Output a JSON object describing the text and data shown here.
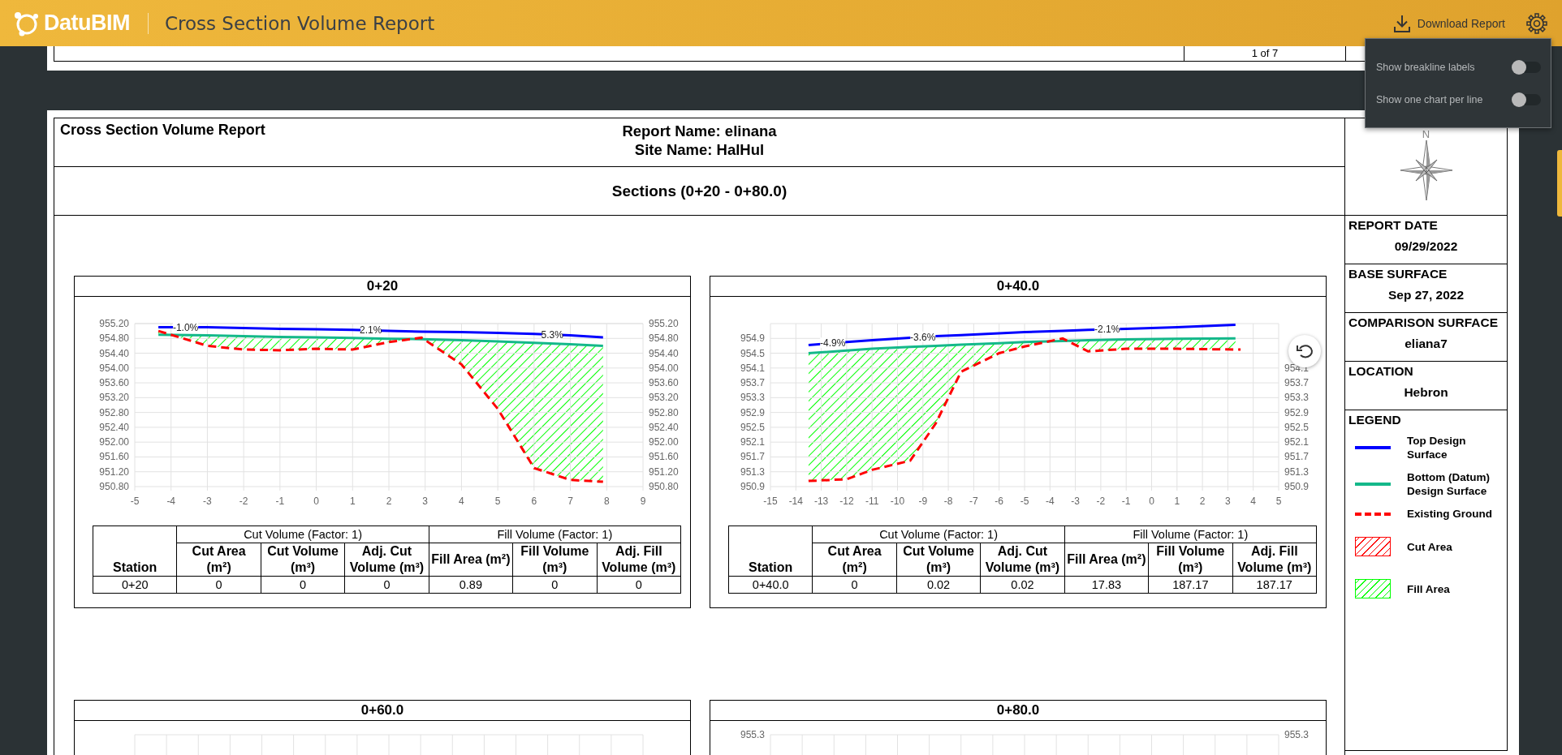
{
  "header": {
    "logo": "DatuBIM",
    "title": "Cross Section Volume Report",
    "download_button": "Download Report"
  },
  "settings_menu": {
    "items": [
      {
        "label": "Show breakline labels",
        "on": false
      },
      {
        "label": "Show one chart per line",
        "on": false
      }
    ]
  },
  "previous_page": {
    "page_number": "1 of 7"
  },
  "report": {
    "title": "Cross Section Volume Report",
    "report_name": "Report Name: elinana",
    "site_name": "Site Name: HalHul",
    "sections_title": "Sections (0+20 - 0+80.0)",
    "compass_label": "N",
    "info": [
      {
        "label": "REPORT DATE",
        "value": "09/29/2022"
      },
      {
        "label": "BASE SURFACE",
        "value": "Sep 27, 2022"
      },
      {
        "label": "COMPARISON SURFACE",
        "value": "eliana7"
      },
      {
        "label": "LOCATION",
        "value": "Hebron"
      }
    ],
    "legend": {
      "title": "LEGEND",
      "items": [
        {
          "label": "Top Design Surface",
          "kind": "line",
          "color": "#0000ff"
        },
        {
          "label": "Bottom (Datum) Design Surface",
          "kind": "line",
          "color": "#14b88a"
        },
        {
          "label": "Existing Ground",
          "kind": "dashed",
          "color": "#ff0000"
        },
        {
          "label": "Cut Area",
          "kind": "hatch",
          "color": "#ff0000"
        },
        {
          "label": "Fill Area",
          "kind": "hatch",
          "color": "#00ff00"
        }
      ]
    },
    "sections": [
      {
        "station": "0+20",
        "reset_button": false,
        "chart_data": {
          "type": "line",
          "grid": true,
          "x": [
            -4.35,
            -3,
            -2,
            -1,
            0,
            1,
            2,
            2.9,
            4,
            5,
            6,
            7,
            7.9
          ],
          "xlim": [
            -5,
            9
          ],
          "ylim": [
            950.8,
            955.2
          ],
          "y2lim": [
            950.8,
            955.2
          ],
          "xticks": [
            -5,
            -4,
            -3,
            -2,
            -1,
            0,
            1,
            2,
            3,
            4,
            5,
            6,
            7,
            8,
            9
          ],
          "yticks": [
            {
              "value": 950.8,
              "label": "950.80"
            },
            {
              "value": 951.2,
              "label": "951.20"
            },
            {
              "value": 951.6,
              "label": "951.60"
            },
            {
              "value": 952,
              "label": "952.00"
            },
            {
              "value": 952.4,
              "label": "952.40"
            },
            {
              "value": 952.8,
              "label": "952.80"
            },
            {
              "value": 953.2,
              "label": "953.20"
            },
            {
              "value": 953.6,
              "label": "953.60"
            },
            {
              "value": 954,
              "label": "954.00"
            },
            {
              "value": 954.4,
              "label": "954.40"
            },
            {
              "value": 954.8,
              "label": "954.80"
            },
            {
              "value": 955.2,
              "label": "955.20"
            }
          ],
          "y2ticks": [
            {
              "value": 950.8,
              "label": "950.80"
            },
            {
              "value": 951.2,
              "label": "951.20"
            },
            {
              "value": 951.6,
              "label": "951.60"
            },
            {
              "value": 952,
              "label": "952.00"
            },
            {
              "value": 952.4,
              "label": "952.40"
            },
            {
              "value": 952.8,
              "label": "952.80"
            },
            {
              "value": 953.2,
              "label": "953.20"
            },
            {
              "value": 953.6,
              "label": "953.60"
            },
            {
              "value": 954,
              "label": "954.00"
            },
            {
              "value": 954.4,
              "label": "954.40"
            },
            {
              "value": 954.8,
              "label": "954.80"
            },
            {
              "value": 955.2,
              "label": "955.20"
            }
          ],
          "series": [
            {
              "color": "#0000ff",
              "line_style": "solid",
              "values": [
                955.1,
                955.1,
                955.08,
                955.06,
                955.05,
                955.03,
                955.0,
                954.98,
                954.97,
                954.95,
                954.92,
                954.88,
                954.83
              ]
            },
            {
              "color": "#14b88a",
              "line_style": "solid",
              "values": [
                954.9,
                954.88,
                954.86,
                954.84,
                954.83,
                954.81,
                954.79,
                954.78,
                954.75,
                954.72,
                954.68,
                954.64,
                954.6
              ]
            },
            {
              "color": "#ff0000",
              "line_style": "dashed",
              "values": [
                955.0,
                954.6,
                954.5,
                954.48,
                954.52,
                954.5,
                954.7,
                954.82,
                954.1,
                952.9,
                951.3,
                950.98,
                950.93
              ]
            }
          ],
          "annotations": [
            {
              "x": -3.6,
              "y": 955.1,
              "text": "-1.0%"
            },
            {
              "x": 1.5,
              "y": 955.02,
              "text": "2.1%"
            },
            {
              "x": 6.5,
              "y": 954.9,
              "text": "5.3%"
            }
          ]
        },
        "table": {
          "group_headers": [
            "Cut Volume (Factor: 1)",
            "Fill Volume (Factor: 1)"
          ],
          "columns": [
            "Station",
            "Cut Area (m²)",
            "Cut Volume (m³)",
            "Adj. Cut Volume (m³)",
            "Fill Area (m²)",
            "Fill Volume (m³)",
            "Adj. Fill Volume (m³)"
          ],
          "rows": [
            [
              "0+20",
              "0",
              "0",
              "0",
              "0.89",
              "0",
              "0"
            ]
          ]
        }
      },
      {
        "station": "0+40.0",
        "reset_button": true,
        "chart_data": {
          "type": "line",
          "grid": true,
          "x": [
            -13.5,
            -12,
            -11,
            -9.5,
            -8.5,
            -7.5,
            -6,
            -5,
            -3.5,
            -2.5,
            -1,
            1,
            3.3,
            3.5
          ],
          "xlim": [
            -15,
            5
          ],
          "ylim": [
            950.9,
            955.3
          ],
          "y2lim": [
            950.9,
            955.3
          ],
          "xticks": [
            -15,
            -14,
            -13,
            -12,
            -11,
            -10,
            -9,
            -8,
            -7,
            -6,
            -5,
            -4,
            -3,
            -2,
            -1,
            0,
            1,
            2,
            3,
            4,
            5
          ],
          "yticks": [
            950.9,
            951.3,
            951.7,
            952.1,
            952.5,
            952.9,
            953.3,
            953.7,
            954.1,
            954.5,
            954.9
          ],
          "y2ticks": [
            950.9,
            951.3,
            951.7,
            952.1,
            952.5,
            952.9,
            953.3,
            953.7,
            954.1
          ],
          "series": [
            {
              "color": "#0000ff",
              "line_style": "solid",
              "values": [
                954.72,
                954.8,
                954.85,
                954.92,
                954.96,
                954.99,
                955.04,
                955.07,
                955.1,
                955.13,
                955.16,
                955.2,
                955.27,
                null
              ]
            },
            {
              "color": "#14b88a",
              "line_style": "solid",
              "values": [
                954.5,
                954.57,
                954.62,
                954.67,
                954.7,
                954.73,
                954.77,
                954.8,
                954.83,
                954.85,
                954.87,
                954.89,
                954.9,
                null
              ]
            },
            {
              "color": "#ff0000",
              "line_style": "dashed",
              "values": [
                951.05,
                951.1,
                951.35,
                951.6,
                952.6,
                954.0,
                954.5,
                954.68,
                954.9,
                954.55,
                954.62,
                954.62,
                954.6,
                954.6
              ]
            }
          ],
          "annotations": [
            {
              "x": -12.55,
              "y": 954.77,
              "text": "-4.9%"
            },
            {
              "x": -9.0,
              "y": 954.93,
              "text": "-3.6%"
            },
            {
              "x": -1.75,
              "y": 955.15,
              "text": "-2.1%"
            }
          ]
        },
        "table": {
          "group_headers": [
            "Cut Volume (Factor: 1)",
            "Fill Volume (Factor: 1)"
          ],
          "columns": [
            "Station",
            "Cut Area (m²)",
            "Cut Volume (m³)",
            "Adj. Cut Volume (m³)",
            "Fill Area (m²)",
            "Fill Volume (m³)",
            "Adj. Fill Volume (m³)"
          ],
          "rows": [
            [
              "0+40.0",
              "0",
              "0.02",
              "0.02",
              "17.83",
              "187.17",
              "187.17"
            ]
          ]
        }
      },
      {
        "station": "0+60.0",
        "reset_button": false
      },
      {
        "station": "0+80.0",
        "reset_button": false,
        "partial_ticks": [
          "955.3",
          "955.3"
        ]
      }
    ]
  }
}
